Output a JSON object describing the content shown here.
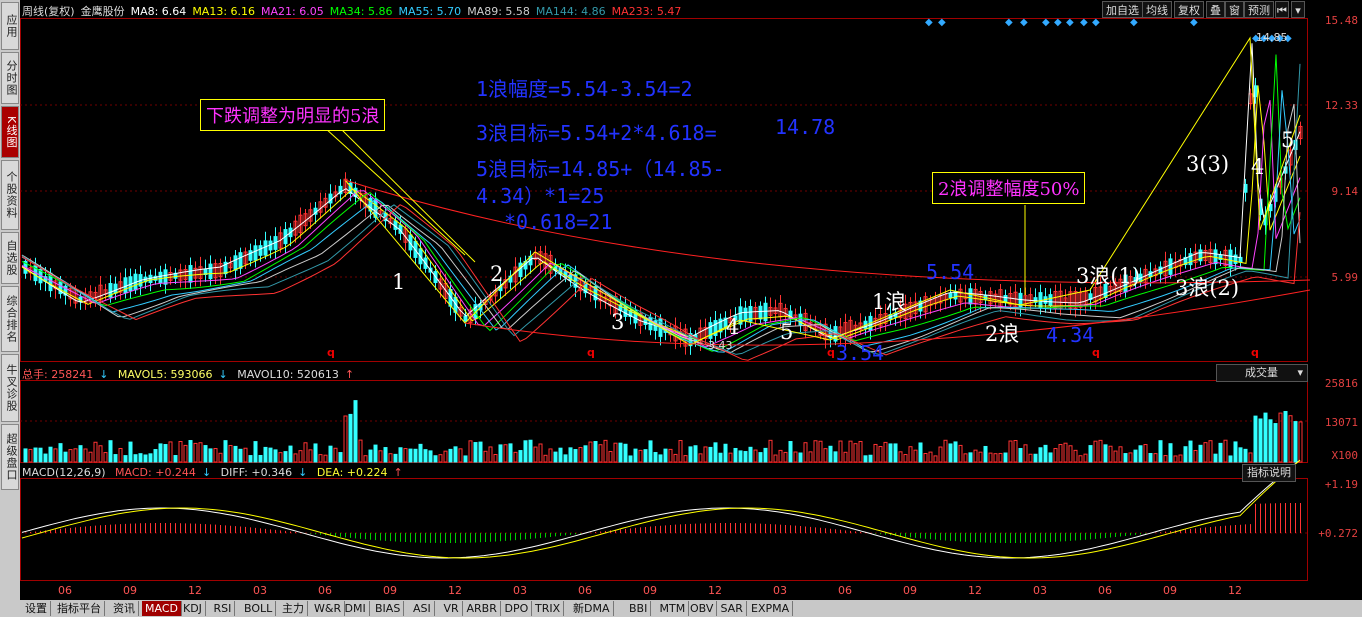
{
  "sidebar": {
    "items": [
      "应用",
      "分时图",
      "K线图",
      "个股资料",
      "自选股",
      "综合排名",
      "牛叉诊股",
      "超级盘口"
    ],
    "active_index": 2
  },
  "top_legend": {
    "period": "周线(复权)",
    "stock": "金鹰股份",
    "ma": [
      {
        "label": "MA8: 6.64",
        "color": "#ffffff"
      },
      {
        "label": "MA13: 6.16",
        "color": "#ffff00"
      },
      {
        "label": "MA21: 6.05",
        "color": "#ff44ff"
      },
      {
        "label": "MA34: 5.86",
        "color": "#00ff00"
      },
      {
        "label": "MA55: 5.70",
        "color": "#33ccff"
      },
      {
        "label": "MA89: 5.58",
        "color": "#cccccc"
      },
      {
        "label": "MA144: 4.86",
        "color": "#3399aa"
      },
      {
        "label": "MA233: 5.47",
        "color": "#ff3333"
      }
    ]
  },
  "toolbar": {
    "buttons": [
      "加自选",
      "均线",
      "复权",
      "叠",
      "窗",
      "预测"
    ]
  },
  "price_axis": {
    "labels": [
      "15.48",
      "12.33",
      "9.14",
      "5.99"
    ]
  },
  "annotations": {
    "wave1_range": "1浪幅度=5.54-3.54=2",
    "wave3_target_prefix": "3浪目标=5.54+2*4.618=",
    "wave3_target_value": "14.78",
    "wave5_target_line1": "5浪目标=14.85+（14.85-",
    "wave5_target_line2": "4.34）*1=25",
    "wave5_target_line3": "*0.618=21",
    "box_left": "下跌调整为明显的5浪",
    "box_right": "2浪调整幅度50%",
    "high_price": "14.85",
    "low_price": "3.43",
    "blue_554": "5.54",
    "blue_354": "3.54",
    "blue_434": "4.34"
  },
  "wave_labels": {
    "w1": "1",
    "w2": "2",
    "w3": "3",
    "w4": "4",
    "w5": "5",
    "lang1": "1浪",
    "lang2": "2浪",
    "lang3_1": "3浪(1)",
    "lang3_2": "3浪(2)",
    "w33": "3(3)",
    "w4b": "4",
    "w5b": "5"
  },
  "volume_legend": {
    "total": "总手: 258241",
    "mavol5": "MAVOL5: 593066",
    "mavol10": "MAVOL10: 520613",
    "dropdown": "成交量",
    "axis": [
      "25816",
      "13071",
      "X100"
    ]
  },
  "macd_legend": {
    "title": "MACD(12,26,9)",
    "macd": "MACD: +0.244",
    "diff": "DIFF: +0.346",
    "dea": "DEA: +0.224",
    "help": "指标说明",
    "axis": [
      "+1.19",
      "+0.272"
    ]
  },
  "x_axis": {
    "labels": [
      "06",
      "09",
      "12",
      "03",
      "06",
      "09",
      "12",
      "03",
      "06",
      "09",
      "12",
      "03",
      "06",
      "09",
      "12",
      "03",
      "06",
      "09",
      "12"
    ]
  },
  "tabs": [
    "设置",
    "指标平台",
    "资讯",
    "MACD",
    "KDJ",
    "RSI",
    "BOLL",
    "主力",
    "W&R",
    "DMI",
    "BIAS",
    "ASI",
    "VR",
    "ARBR",
    "DPO",
    "TRIX",
    "新DMA",
    "BBI",
    "MTM",
    "OBV",
    "SAR",
    "EXPMA"
  ],
  "active_tab": "MACD",
  "q_mark": "q"
}
